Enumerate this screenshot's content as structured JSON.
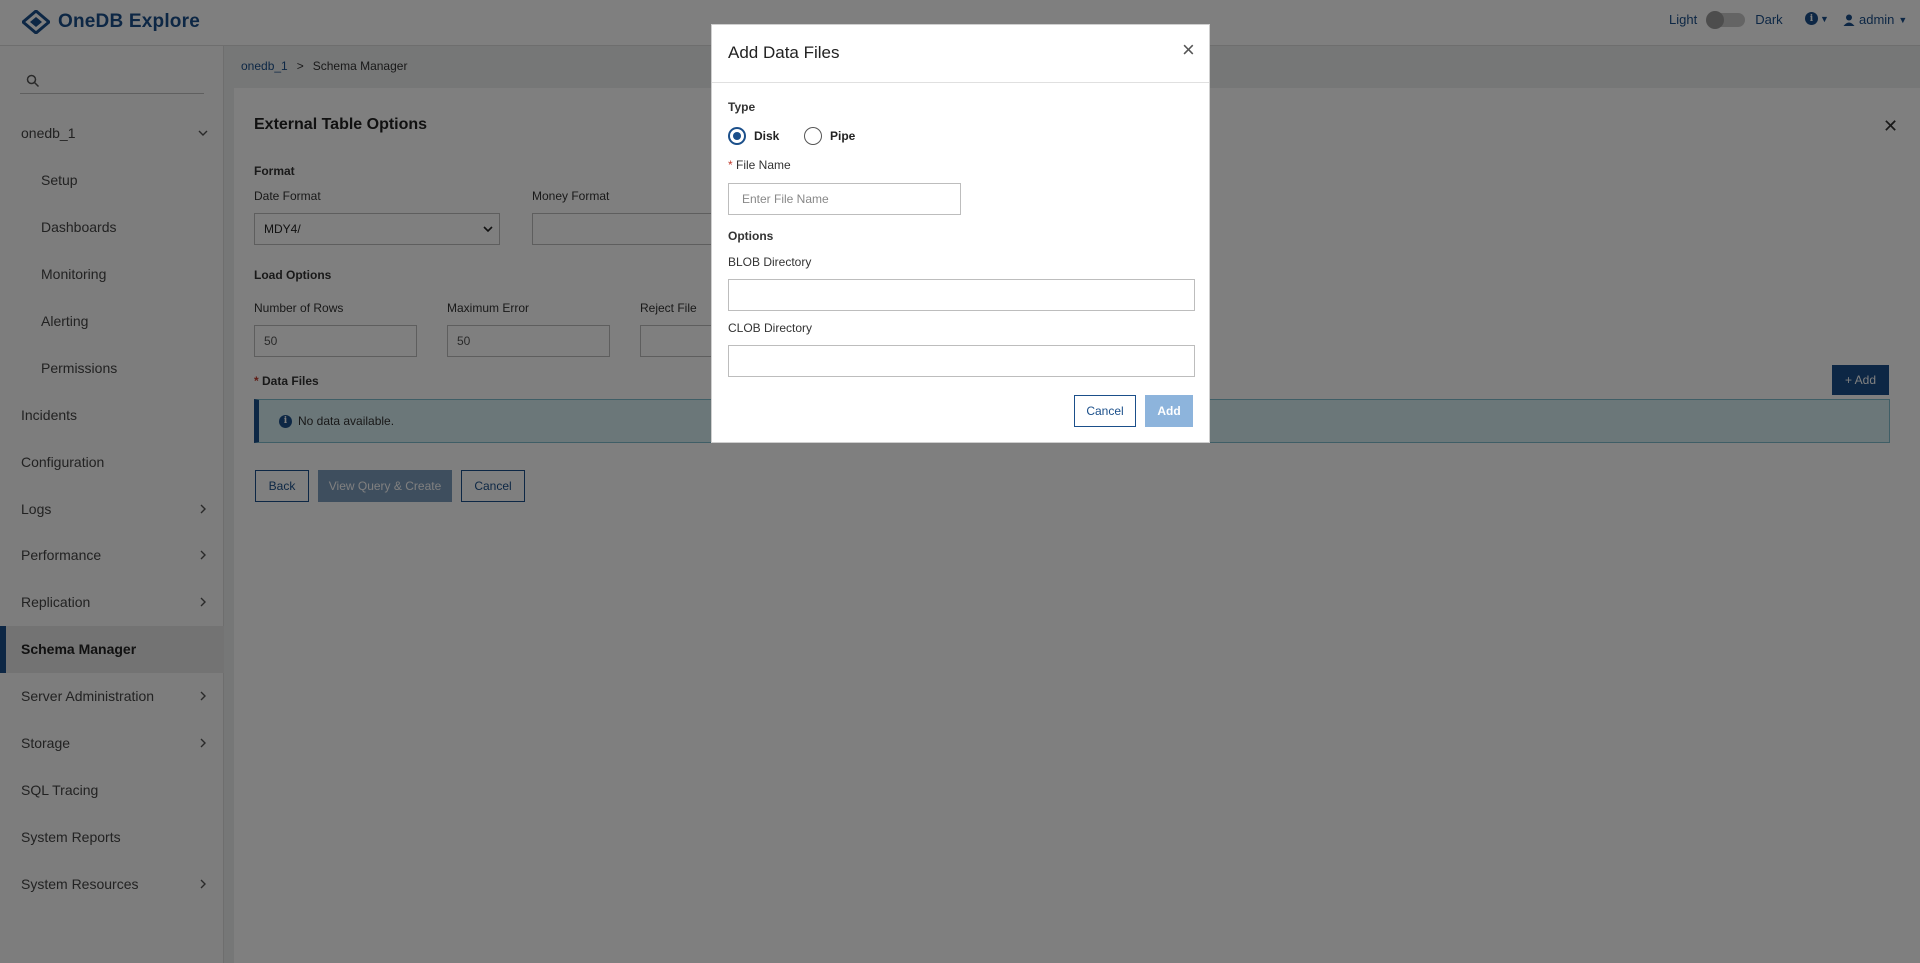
{
  "app": {
    "title": "OneDB Explore",
    "brand_color": "#1b4f8a"
  },
  "header": {
    "theme_light": "Light",
    "theme_dark": "Dark",
    "user": "admin"
  },
  "sidebar": {
    "search_placeholder": "",
    "items": [
      {
        "label": "onedb_1",
        "chevron": "down"
      },
      {
        "label": "Setup"
      },
      {
        "label": "Dashboards"
      },
      {
        "label": "Monitoring"
      },
      {
        "label": "Alerting"
      },
      {
        "label": "Permissions"
      },
      {
        "label": "Incidents"
      },
      {
        "label": "Configuration"
      },
      {
        "label": "Logs",
        "chevron": "right"
      },
      {
        "label": "Performance",
        "chevron": "right"
      },
      {
        "label": "Replication",
        "chevron": "right"
      },
      {
        "label": "Schema Manager",
        "active": true
      },
      {
        "label": "Server Administration",
        "chevron": "right"
      },
      {
        "label": "Storage",
        "chevron": "right"
      },
      {
        "label": "SQL Tracing"
      },
      {
        "label": "System Reports"
      },
      {
        "label": "System Resources",
        "chevron": "right"
      }
    ]
  },
  "breadcrumb": {
    "root": "onedb_1",
    "separator": ">",
    "current": "Schema Manager"
  },
  "panel": {
    "title": "External Table Options",
    "format_heading": "Format",
    "date_format_label": "Date Format",
    "date_format_value": "MDY4/",
    "money_format_label": "Money Format",
    "money_format_value": "",
    "load_options_heading": "Load Options",
    "rows_label": "Number of Rows",
    "rows_value": "50",
    "max_error_label": "Maximum Error",
    "max_error_value": "50",
    "reject_file_label": "Reject File",
    "reject_file_value": "",
    "data_files_required": "*",
    "data_files_label": "Data Files",
    "add_button": "+ Add",
    "no_data": "No data available.",
    "back_button": "Back",
    "view_query_button": "View Query & Create",
    "cancel_button": "Cancel"
  },
  "modal": {
    "title": "Add Data Files",
    "type_label": "Type",
    "type_options": [
      "Disk",
      "Pipe"
    ],
    "type_selected": "Disk",
    "file_name_required": "*",
    "file_name_label": "File Name",
    "file_name_placeholder": "Enter File Name",
    "options_label": "Options",
    "blob_label": "BLOB Directory",
    "clob_label": "CLOB Directory",
    "cancel_button": "Cancel",
    "add_button": "Add"
  }
}
